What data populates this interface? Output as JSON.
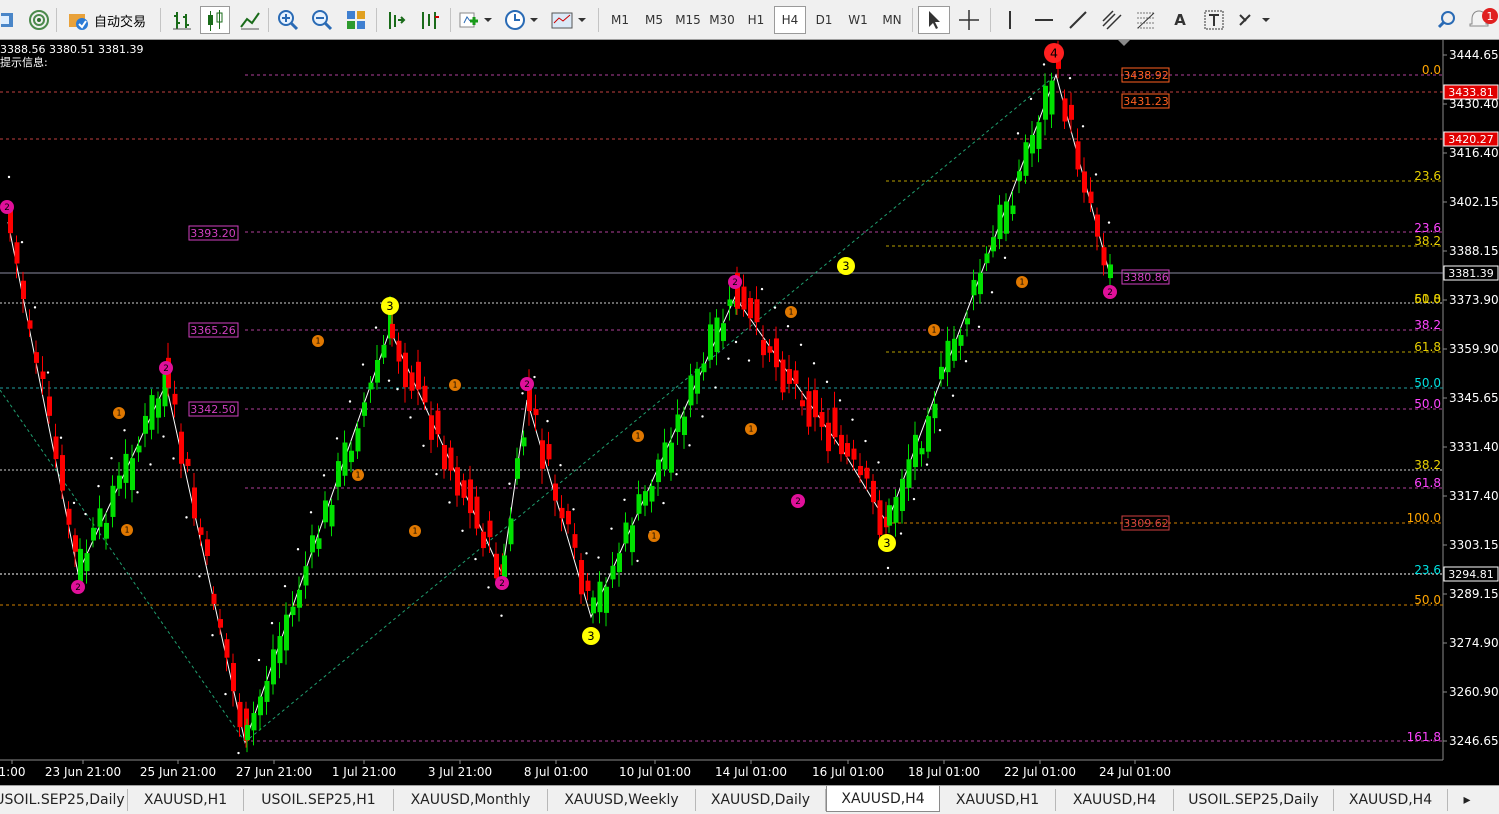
{
  "toolbar": {
    "auto_trading_label": "自动交易",
    "timeframes": [
      "M1",
      "M5",
      "M15",
      "M30",
      "H1",
      "H4",
      "D1",
      "W1",
      "MN"
    ],
    "active_timeframe": "H4",
    "notification_count": "1"
  },
  "chart": {
    "symbol": "XAUUSD",
    "timeframe": "H4",
    "ohlc_line": "3388.56 3380.51 3381.39",
    "info_label": "提示信息:",
    "current_price": "3381.39",
    "background": "#000000",
    "bull_color": "#00e000",
    "bear_color": "#ff0000",
    "price_ticks": [
      "3444.65",
      "3430.40",
      "3416.40",
      "3402.15",
      "3388.15",
      "3373.90",
      "3359.90",
      "3345.65",
      "3331.40",
      "3317.40",
      "3303.15",
      "3289.15",
      "3274.90",
      "3260.90",
      "3246.65"
    ],
    "price_tags": [
      {
        "text": "3433.81",
        "bg": "#e00000"
      },
      {
        "text": "3420.27",
        "bg": "#e00000"
      },
      {
        "text": "3381.39",
        "bg": "#000000"
      },
      {
        "text": "3294.81",
        "bg": "#000000"
      }
    ],
    "time_ticks": [
      "1:00",
      "23 Jun 21:00",
      "25 Jun 21:00",
      "27 Jun 21:00",
      "1 Jul 21:00",
      "3 Jul 21:00",
      "8 Jul 01:00",
      "10 Jul 01:00",
      "14 Jul 01:00",
      "16 Jul 01:00",
      "18 Jul 01:00",
      "22 Jul 01:00",
      "24 Jul 01:00"
    ],
    "left_labels": [
      "3393.20",
      "3365.26",
      "3342.50"
    ],
    "right_labels": [
      "3438.92",
      "3431.23",
      "3380.86",
      "3309.62"
    ],
    "fib_levels": [
      {
        "text": "0.0",
        "color": "#ffa500"
      },
      {
        "text": "23.6",
        "color": "#e8d000"
      },
      {
        "text": "23.6",
        "color": "#ff44ff"
      },
      {
        "text": "38.2",
        "color": "#e8d000"
      },
      {
        "text": "50.0",
        "color": "#e8d000"
      },
      {
        "text": "61.8",
        "color": "#e8d000"
      },
      {
        "text": "38.2",
        "color": "#ff44ff"
      },
      {
        "text": "61.8",
        "color": "#e8d000"
      },
      {
        "text": "50.0",
        "color": "#00e0e0"
      },
      {
        "text": "50.0",
        "color": "#ff44ff"
      },
      {
        "text": "38.2",
        "color": "#e8d000"
      },
      {
        "text": "61.8",
        "color": "#ff44ff"
      },
      {
        "text": "100.0",
        "color": "#ffa500"
      },
      {
        "text": "23.6",
        "color": "#00e0e0"
      },
      {
        "text": "50.0",
        "color": "#ffa500"
      },
      {
        "text": "161.8",
        "color": "#ff44ff"
      }
    ],
    "wave_markers": [
      {
        "text": "4",
        "color": "#ff2020"
      },
      {
        "text": "3",
        "color": "#ffff00"
      },
      {
        "text": "3",
        "color": "#ffff00"
      },
      {
        "text": "3",
        "color": "#ffff00"
      },
      {
        "text": "3",
        "color": "#ffff00"
      },
      {
        "text": "2",
        "color": "#e0109a"
      },
      {
        "text": "1",
        "color": "#e07800"
      }
    ]
  },
  "tabs": [
    {
      "label": "USOIL.SEP25,Daily"
    },
    {
      "label": "XAUUSD,H1"
    },
    {
      "label": "USOIL.SEP25,H1"
    },
    {
      "label": "XAUUSD,Monthly"
    },
    {
      "label": "XAUUSD,Weekly"
    },
    {
      "label": "XAUUSD,Daily"
    },
    {
      "label": "XAUUSD,H4",
      "active": true
    },
    {
      "label": "XAUUSD,H1"
    },
    {
      "label": "XAUUSD,H4"
    },
    {
      "label": "USOIL.SEP25,Daily"
    },
    {
      "label": "XAUUSD,H4"
    }
  ]
}
